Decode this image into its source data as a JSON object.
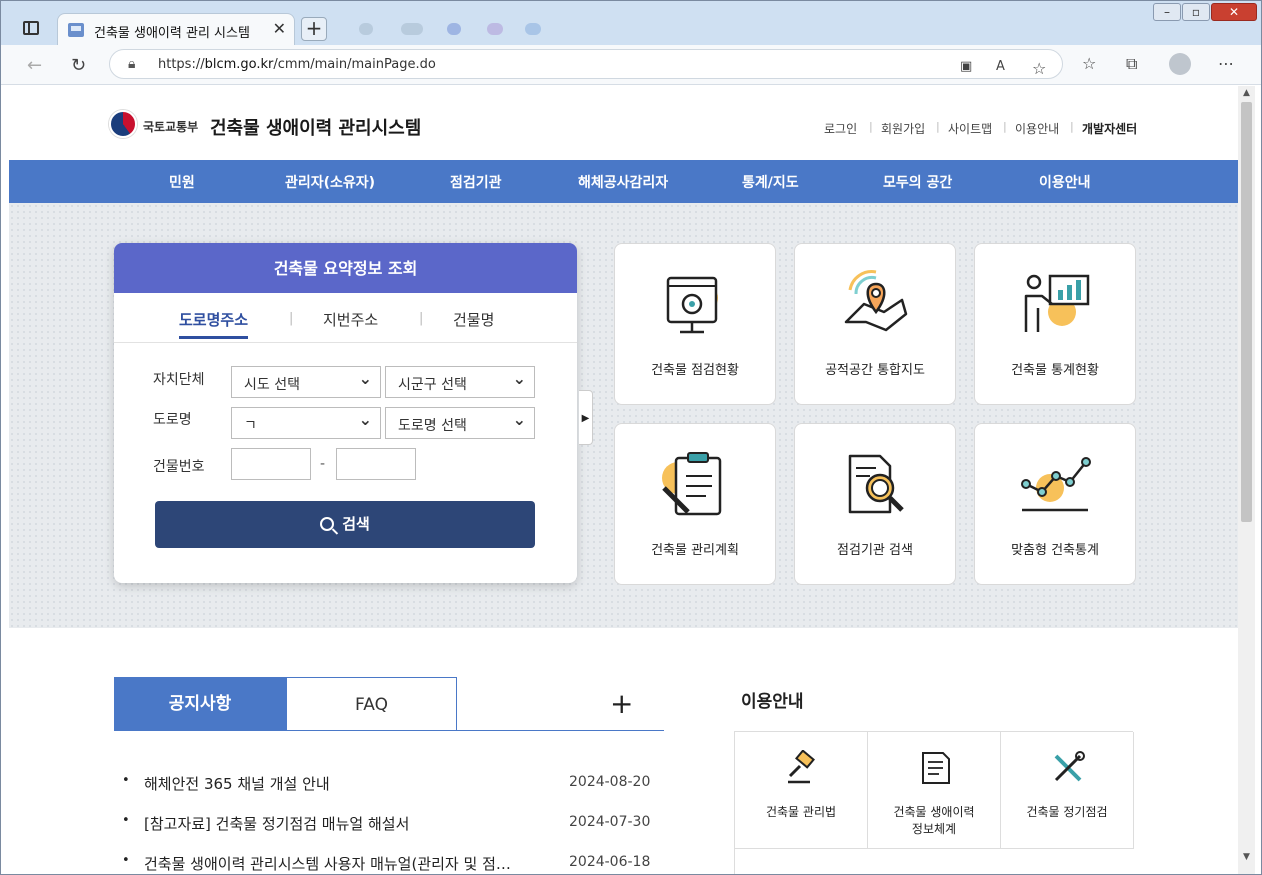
{
  "browser": {
    "tab_title": "건축물 생애이력 관리 시스템",
    "url_prefix": "https://",
    "url_host": "blcm.go.kr",
    "url_path": "/cmm/main/mainPage.do",
    "new_tab": "+",
    "tab_close": "✕"
  },
  "header": {
    "ministry": "국토교통부",
    "title": "건축물 생애이력 관리시스템",
    "util_links": [
      "로그인",
      "회원가입",
      "사이트맵",
      "이용안내",
      "개발자센터"
    ]
  },
  "gnb": [
    "민원",
    "관리자(소유자)",
    "점검기관",
    "해체공사감리자",
    "통계/지도",
    "모두의 공간",
    "이용안내"
  ],
  "search": {
    "title": "건축물 요약정보 조회",
    "tabs": [
      "도로명주소",
      "지번주소",
      "건물명"
    ],
    "label_region": "자치단체",
    "label_road": "도로명",
    "label_bldno": "건물번호",
    "sido": "시도 선택",
    "sigungu": "시군구 선택",
    "initial": "ㄱ",
    "road": "도로명 선택",
    "dash": "-",
    "button": "검색"
  },
  "quick_menu": [
    {
      "label": "건축물 점검현황",
      "icon": "monitor-gear-icon"
    },
    {
      "label": "공적공간 통합지도",
      "icon": "map-pin-icon"
    },
    {
      "label": "건축물 통계현황",
      "icon": "presenter-chart-icon"
    },
    {
      "label": "건축물 관리계획",
      "icon": "clipboard-pen-icon"
    },
    {
      "label": "점검기관 검색",
      "icon": "document-search-icon"
    },
    {
      "label": "맞춤형 건축통계",
      "icon": "line-graph-icon"
    }
  ],
  "notice": {
    "tab_notice": "공지사항",
    "tab_faq": "FAQ",
    "more": "+",
    "bullet": "•",
    "items": [
      {
        "title": "해체안전 365 채널 개설 안내",
        "date": "2024-08-20"
      },
      {
        "title": "[참고자료] 건축물 정기점검 매뉴얼 해설서",
        "date": "2024-07-30"
      },
      {
        "title": "건축물 생애이력 관리시스템 사용자 매뉴얼(관리자 및 점검기관용)",
        "date": "2024-06-18"
      }
    ]
  },
  "guide": {
    "title": "이용안내",
    "items": [
      {
        "label": "건축물 관리법",
        "icon": "gavel-icon"
      },
      {
        "label": "건축물 생애이력 정보체계",
        "line1": "건축물 생애이력",
        "line2": "정보체계",
        "icon": "document-icon"
      },
      {
        "label": "건축물 정기점검",
        "icon": "tools-icon"
      }
    ]
  },
  "colors": {
    "gnb": "#4a78c7",
    "search_head": "#5b67c9",
    "search_button": "#2d4677",
    "accent_orange": "#f7c15a"
  }
}
